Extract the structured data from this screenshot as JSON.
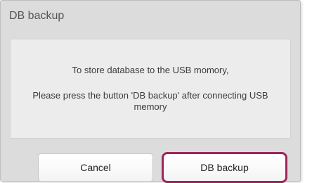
{
  "dialog": {
    "title": "DB backup",
    "message_line1": "To store database to the USB momory,",
    "message_line2": "Please press the button 'DB backup' after connecting USB memory",
    "cancel_label": "Cancel",
    "backup_label": "DB backup"
  },
  "colors": {
    "dialog_background": "#dcdcdc",
    "panel_background": "#ececec",
    "highlight_border": "#a0245b"
  }
}
